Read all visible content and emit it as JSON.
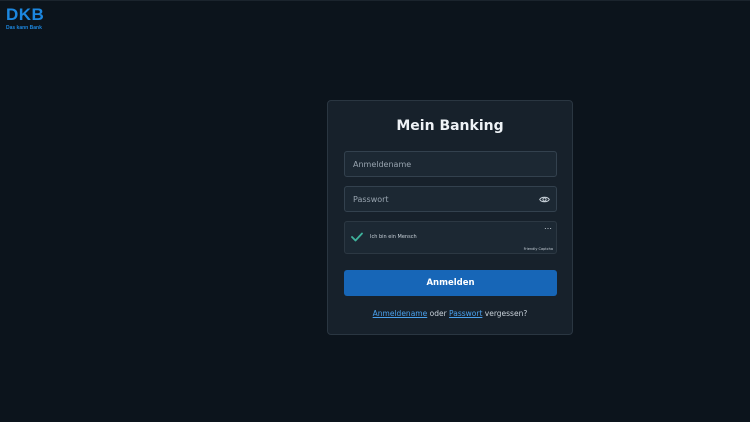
{
  "brand": {
    "logo_text": "DKB",
    "tagline": "Das kann Bank",
    "accent_color": "#1c87e0"
  },
  "login": {
    "title": "Mein Banking",
    "username_placeholder": "Anmeldename",
    "password_placeholder": "Passwort",
    "password_toggle_icon": "eye-icon",
    "captcha": {
      "label": "Ich bin ein Mensch",
      "brand": "Friendly Captcha",
      "menu_icon": "…",
      "status": "verified",
      "check_color": "#3fb39c"
    },
    "submit_label": "Anmelden",
    "submit_color": "#1766b7",
    "forgot": {
      "link_username": "Anmeldename",
      "separator": " oder ",
      "link_password": "Passwort",
      "suffix": " vergessen?"
    }
  }
}
